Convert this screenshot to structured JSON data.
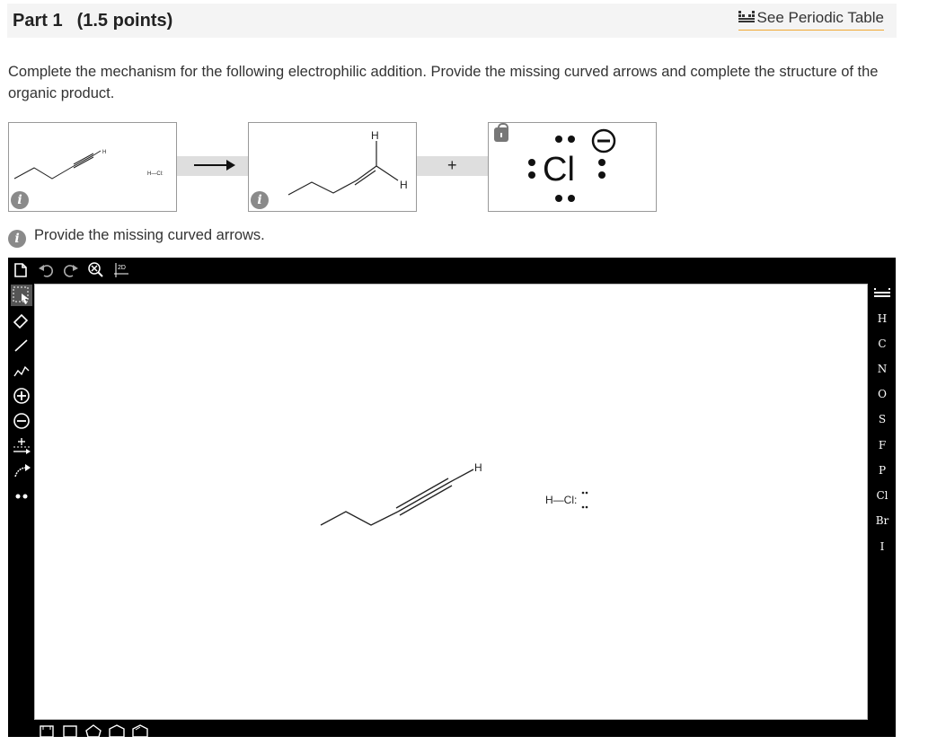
{
  "header": {
    "part_label": "Part 1",
    "points": "(1.5 points)",
    "periodic_link": "See Periodic Table"
  },
  "question": {
    "text": "Complete the mechanism for the following electrophilic addition. Provide the missing curved arrows and complete the structure of the organic product."
  },
  "reaction": {
    "reactant_alkyne_h": "H",
    "reactant_hcl": "H—Cl:",
    "product_h_top": "H",
    "product_h_right": "H",
    "plus": "+",
    "chloride_symbol": "Cl",
    "info_icon": "i"
  },
  "instruction": "Provide the missing curved arrows.",
  "editor": {
    "top_toolbar": [
      "new-document-icon",
      "undo-icon",
      "redo-icon",
      "zoom-clear-icon",
      "2d-clean-icon"
    ],
    "clean_2d_label": "2D",
    "left_toolbar": [
      "select-icon",
      "eraser-icon",
      "single-bond-icon",
      "chain-icon",
      "positive-charge-icon",
      "negative-charge-icon",
      "electron-push-icon",
      "curved-arrow-icon",
      "lone-pair-icon"
    ],
    "elements": [
      "H",
      "C",
      "N",
      "O",
      "S",
      "F",
      "P",
      "Cl",
      "Br",
      "I"
    ],
    "canvas": {
      "alkyne_h": "H",
      "hcl_label": "H—Cl:"
    },
    "bottom_toolbar": [
      "cyclopropane-icon",
      "cyclobutane-icon",
      "cyclopentane-icon",
      "cyclohexane-icon",
      "benzene-icon"
    ]
  }
}
